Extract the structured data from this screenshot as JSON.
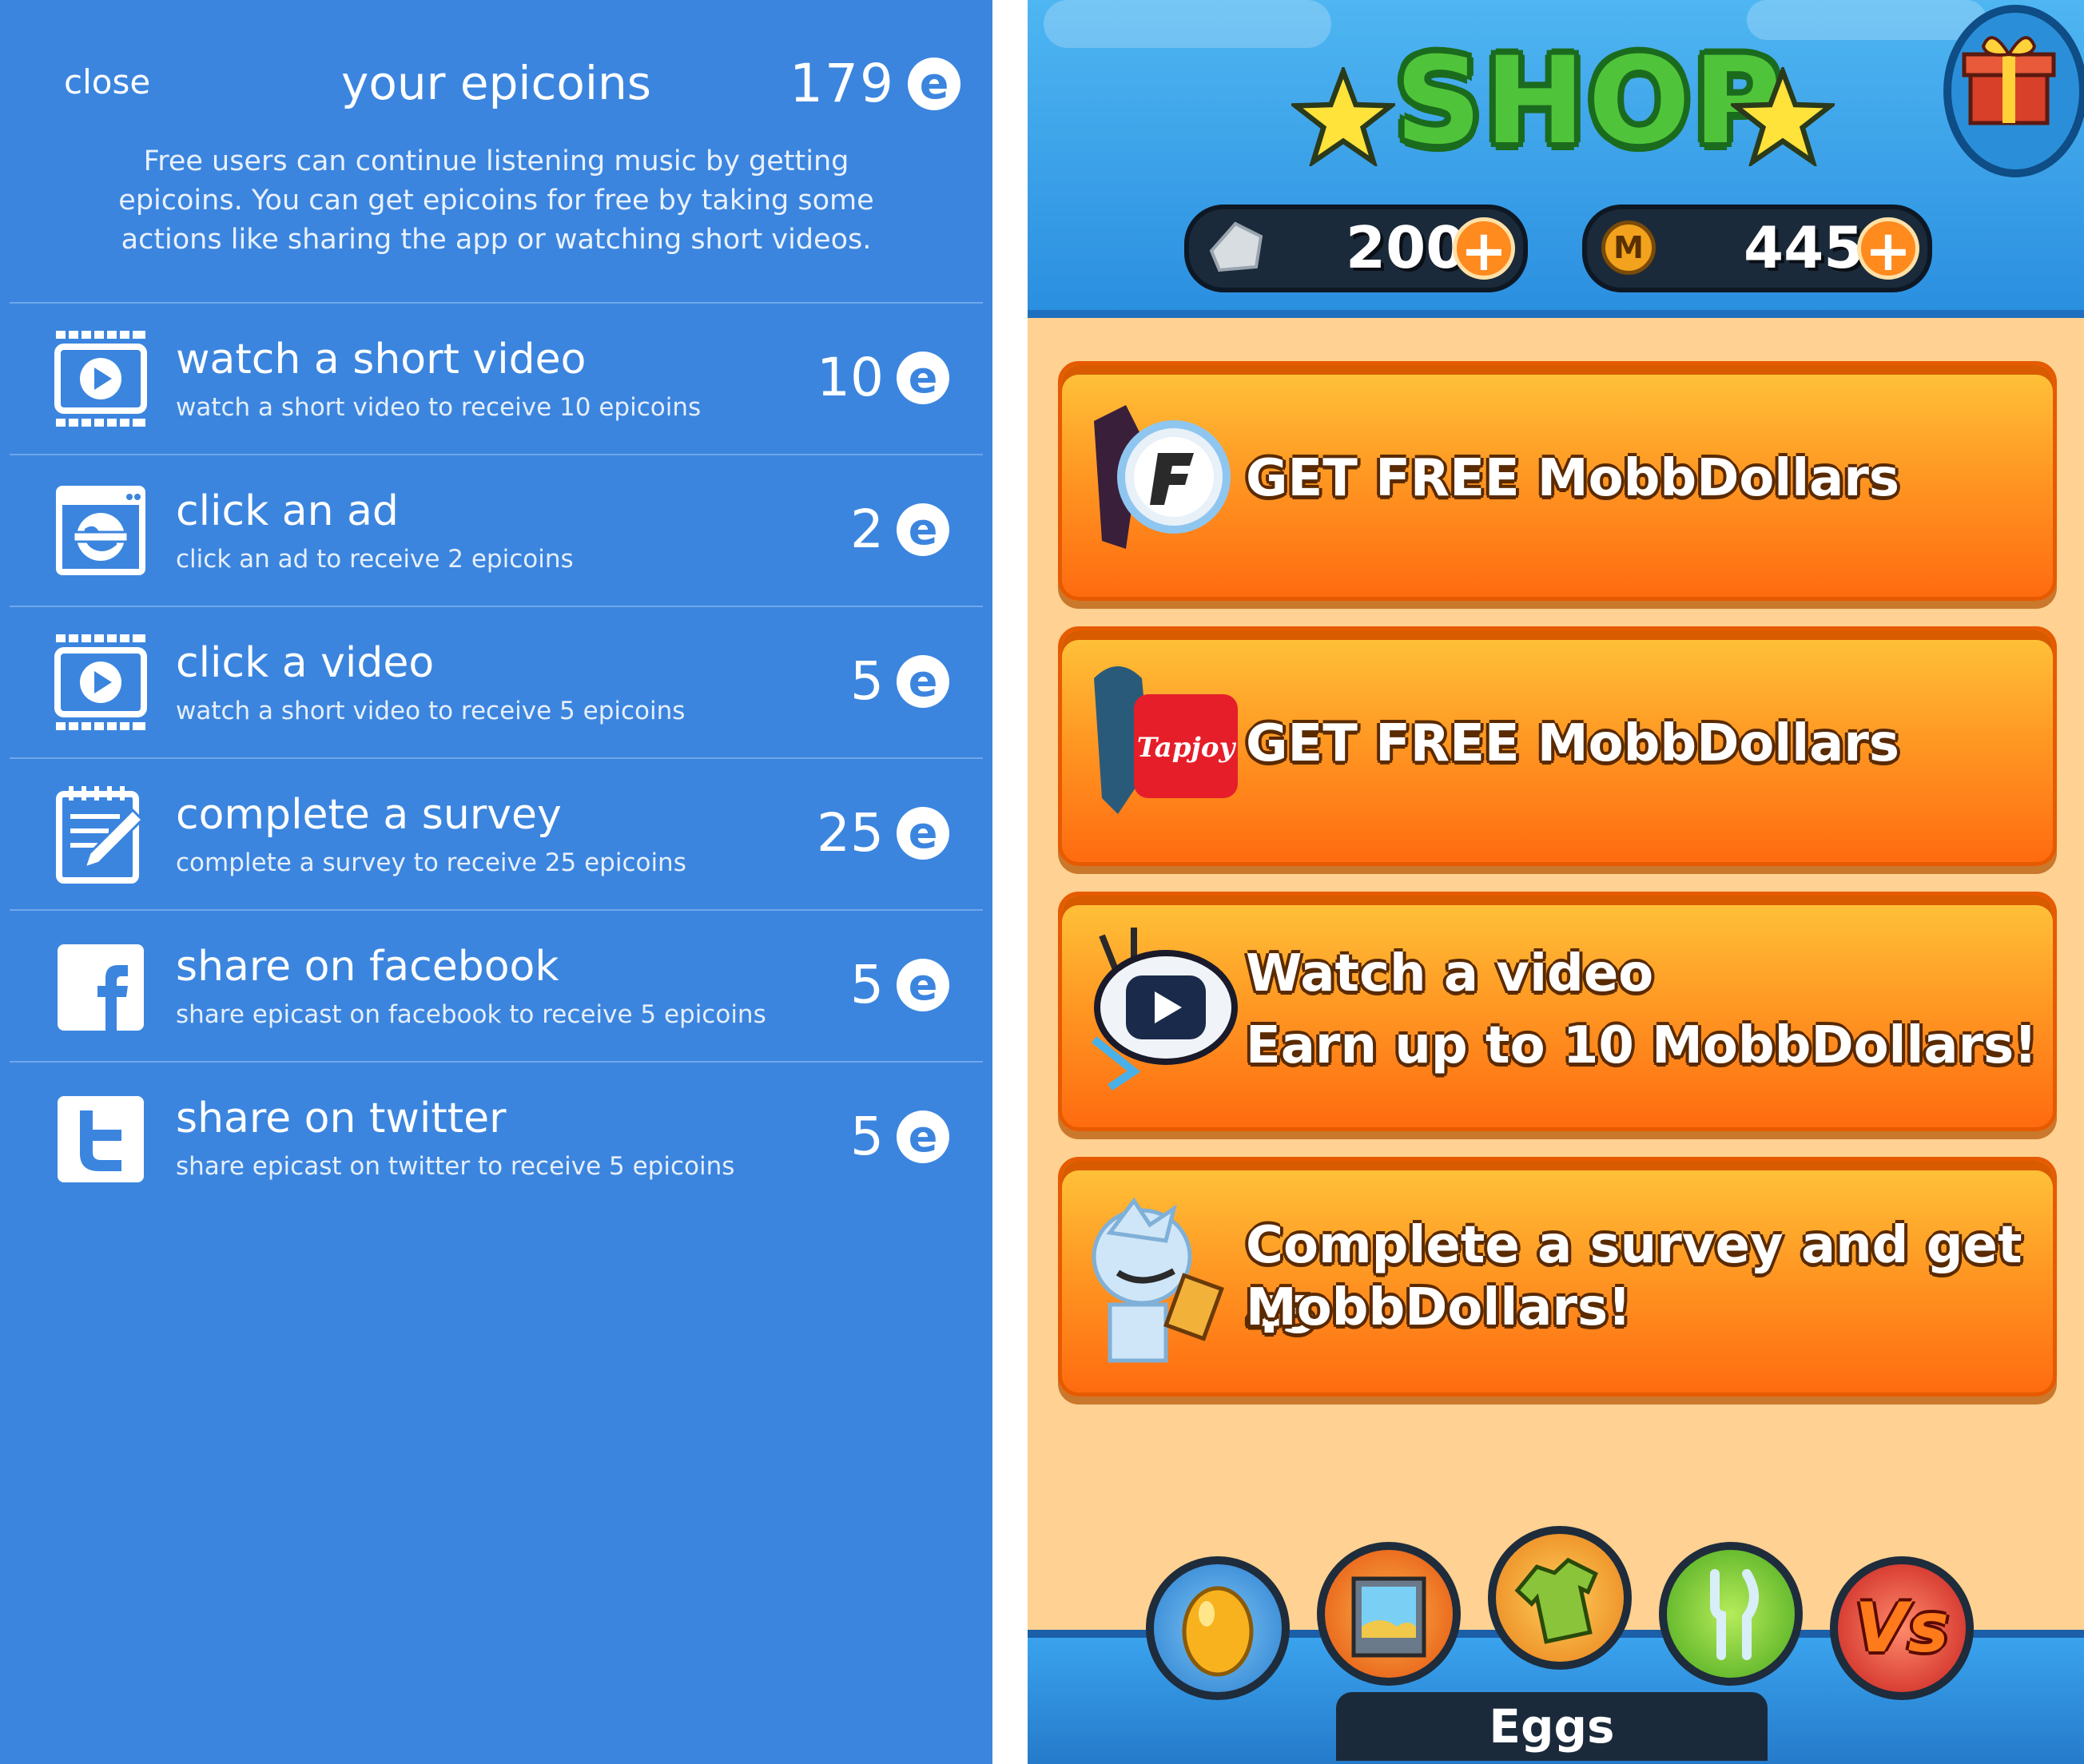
{
  "epicoins": {
    "close_label": "close",
    "title": "your epicoins",
    "balance": "179",
    "coin_letter": "e",
    "description": "Free users can continue listening music by getting epicoins. You can get epicoins for free by taking some actions like sharing the app or watching short videos.",
    "actions": [
      {
        "icon": "video-icon",
        "title": "watch a short video",
        "subtitle": "watch a short video to receive 10 epicoins",
        "amount": "10"
      },
      {
        "icon": "ad-browser-icon",
        "title": "click an ad",
        "subtitle": "click an ad to receive 2 epicoins",
        "amount": "2"
      },
      {
        "icon": "video-icon",
        "title": "click a video",
        "subtitle": "watch a short video to receive 5 epicoins",
        "amount": "5"
      },
      {
        "icon": "survey-icon",
        "title": "complete a survey",
        "subtitle": "complete a survey to receive 25 epicoins",
        "amount": "25"
      },
      {
        "icon": "facebook-icon",
        "title": "share on facebook",
        "subtitle": "share epicast on facebook to receive 5 epicoins",
        "amount": "5"
      },
      {
        "icon": "twitter-icon",
        "title": "share on twitter",
        "subtitle": "share epicast on twitter to receive 5 epicoins",
        "amount": "5"
      }
    ],
    "colors": {
      "background": "#3b85df",
      "divider": "#6fa7ea"
    }
  },
  "shop": {
    "title": "SHOP",
    "gems": "200",
    "coins": "445",
    "coin_letter": "M",
    "offers": [
      {
        "line1": "GET FREE MobbDollars",
        "line2": "",
        "provider_icon": "fyber-icon"
      },
      {
        "line1": "GET FREE MobbDollars",
        "line2": "",
        "provider_icon": "tapjoy-icon",
        "provider_label": "Tapjoy"
      },
      {
        "line1": "Watch a video",
        "line2": "Earn up to 10 MobbDollars!",
        "provider_icon": "video-robot-icon"
      },
      {
        "line1": "Complete a survey and get 45",
        "line2": "MobbDollars!",
        "provider_icon": "survey-character-icon"
      }
    ],
    "nav": [
      {
        "icon": "egg-icon"
      },
      {
        "icon": "picture-frame-icon"
      },
      {
        "icon": "shirt-icon"
      },
      {
        "icon": "cutlery-icon"
      },
      {
        "icon": "versus-icon",
        "label": "Vs"
      }
    ],
    "selected_nav_label": "Eggs",
    "colors": {
      "background": "#ffd192",
      "offer_button": "#ff9a24",
      "title_green": "#4fc43a"
    }
  }
}
